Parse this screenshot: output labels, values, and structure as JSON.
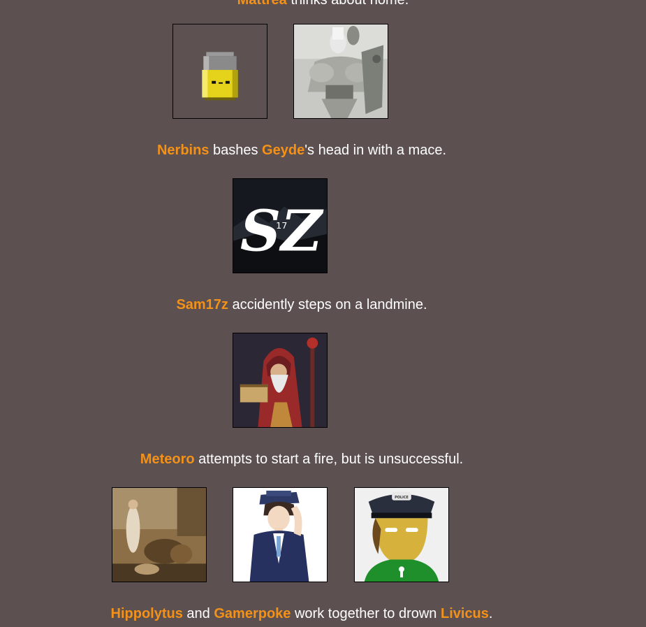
{
  "events": [
    {
      "id": "partial",
      "actor": "Mattrea",
      "text": " thinks about home."
    },
    {
      "id": "event-1",
      "actor": "Nerbins",
      "middle": " bashes ",
      "target": "Geyde",
      "text": "'s head in with a mace."
    },
    {
      "id": "event-2",
      "actor": "Sam17z",
      "text": " accidently steps on a landmine."
    },
    {
      "id": "event-3",
      "actor": "Meteoro",
      "text": " attempts to start a fire, but is unsuccessful."
    },
    {
      "id": "event-4",
      "actor1": "Hippolytus",
      "and": " and ",
      "actor2": "Gamerpoke",
      "middle": " work together to drown ",
      "target": "Livicus",
      "end": "."
    }
  ],
  "avatars": {
    "sz_text": "SZ",
    "sz_sub": "17",
    "police_badge": "POLICE"
  },
  "colors": {
    "background": "#5c5150",
    "name": "#f39119",
    "text": "#ffffff"
  }
}
